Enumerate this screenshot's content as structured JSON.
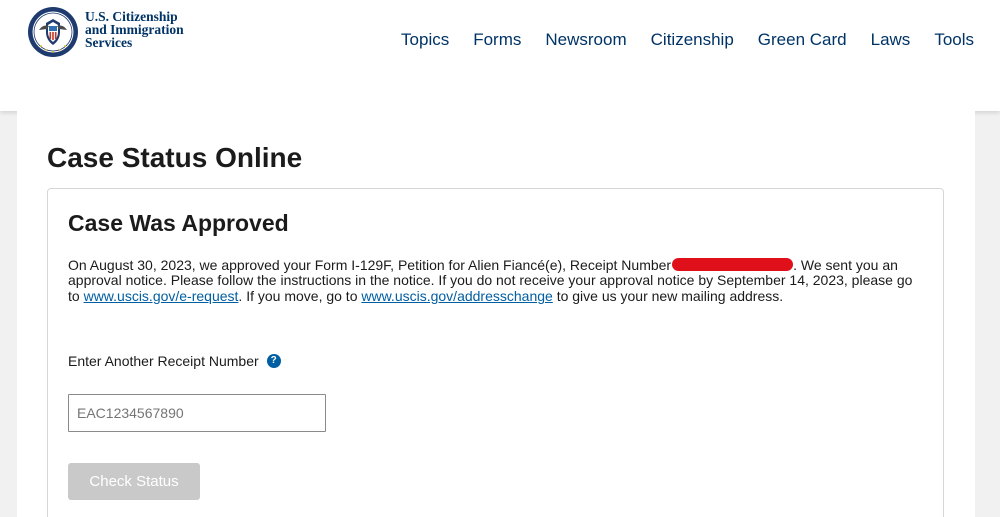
{
  "header": {
    "logo": {
      "line1": "U.S. Citizenship",
      "line2": "and Immigration",
      "line3": "Services",
      "seal_text_top": "U.S. DEPARTMENT OF",
      "seal_text_bottom": "HOMELAND SECURITY",
      "seal_icon": "dhs-seal-icon"
    },
    "nav": [
      "Topics",
      "Forms",
      "Newsroom",
      "Citizenship",
      "Green Card",
      "Laws",
      "Tools"
    ]
  },
  "main": {
    "page_title": "Case Status Online",
    "card": {
      "status_title": "Case Was Approved",
      "desc_part1": "On August 30, 2023, we approved your Form I-129F, Petition for Alien Fiancé(e), Receipt Number",
      "desc_part2": ". We sent you an approval notice. Please follow the instructions in the notice. If you do not receive your approval notice by September 14, 2023, please go to ",
      "link1": "www.uscis.gov/e-request",
      "desc_part3": ". If you move, go to ",
      "link2": "www.uscis.gov/addresschange",
      "desc_part4": " to give us your new mailing address.",
      "field_label": "Enter Another Receipt Number",
      "help_icon": "question-circle-icon",
      "input_placeholder": "EAC1234567890",
      "input_value": "",
      "button_label": "Check Status"
    }
  },
  "colors": {
    "brand_navy": "#003366",
    "link_blue": "#005ea2",
    "redaction_red": "#e0101a",
    "disabled_button": "#c9c9c9",
    "page_bg": "#f1f1f1"
  }
}
